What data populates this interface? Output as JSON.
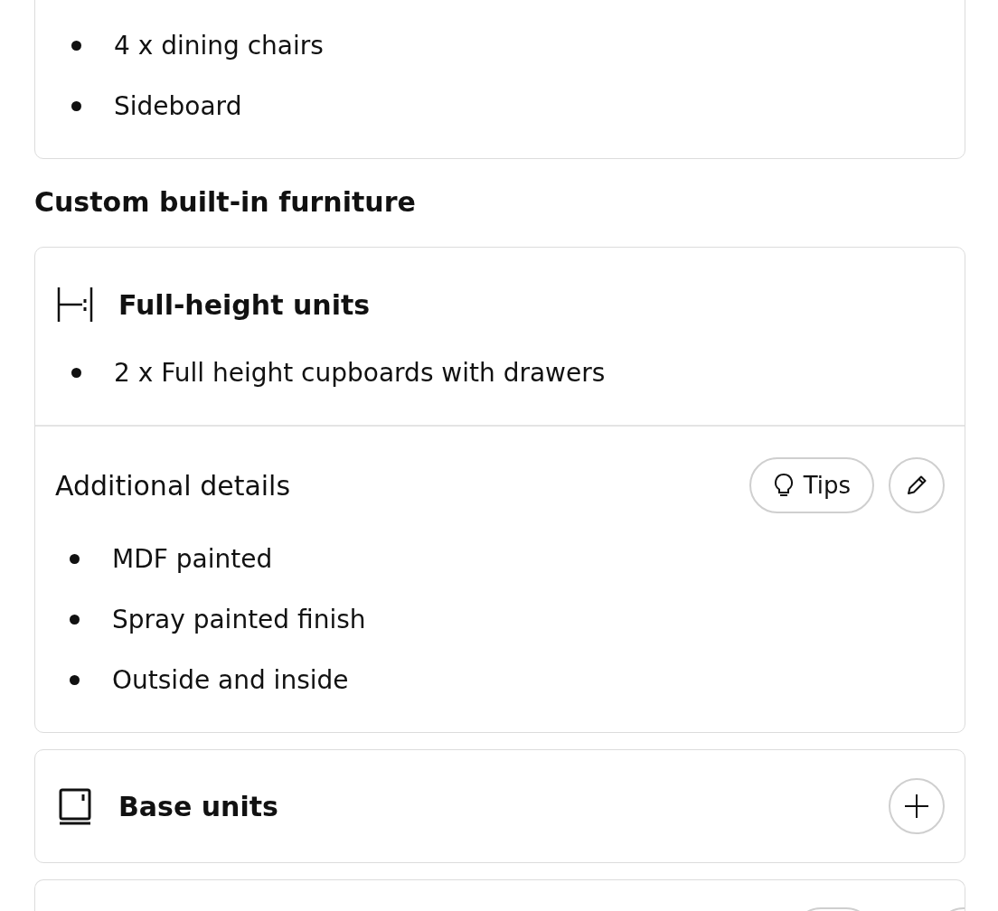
{
  "top_card": {
    "items": [
      "4 x dining chairs",
      "Sideboard"
    ]
  },
  "section_title": "Custom built-in furniture",
  "units": [
    {
      "kind": "full-height",
      "title": "Full-height units",
      "expanded": true,
      "items": [
        "2 x Full height cupboards with drawers"
      ],
      "details": {
        "label": "Additional details",
        "tips_label": "Tips",
        "items": [
          "MDF painted",
          "Spray painted finish",
          "Outside and inside"
        ]
      }
    },
    {
      "kind": "base",
      "title": "Base units",
      "expanded": false
    }
  ]
}
